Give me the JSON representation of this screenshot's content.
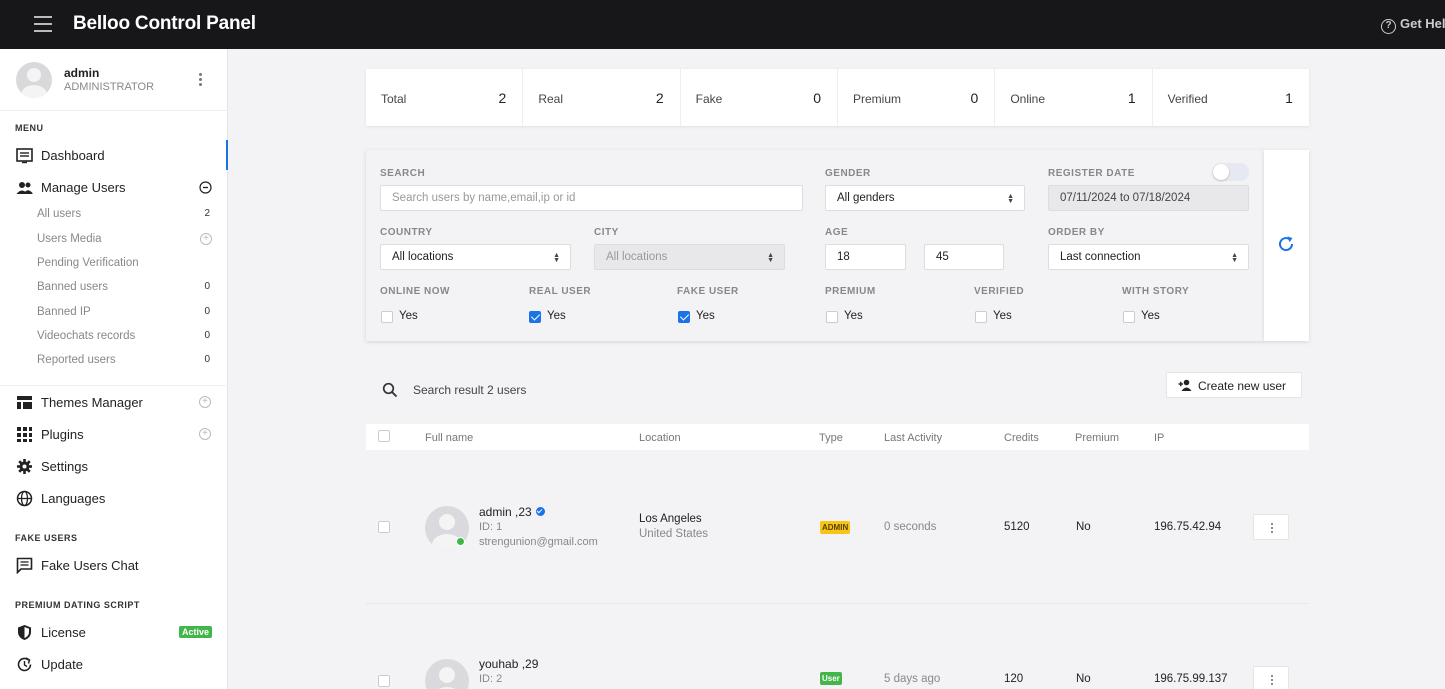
{
  "topbar": {
    "title": "Belloo Control Panel",
    "help": "Get Hel"
  },
  "profile": {
    "name": "admin",
    "role": "ADMINISTRATOR"
  },
  "sidebar": {
    "menu_label": "MENU",
    "dashboard": "Dashboard",
    "manage_users": "Manage Users",
    "sub_items": [
      {
        "label": "All users",
        "count": "2"
      },
      {
        "label": "Users Media",
        "count": ""
      },
      {
        "label": "Pending Verification",
        "count": ""
      },
      {
        "label": "Banned users",
        "count": "0"
      },
      {
        "label": "Banned IP",
        "count": "0"
      },
      {
        "label": "Videochats records",
        "count": "0"
      },
      {
        "label": "Reported users",
        "count": "0"
      }
    ],
    "themes_manager": "Themes Manager",
    "plugins": "Plugins",
    "settings": "Settings",
    "languages": "Languages",
    "fake_users_label": "FAKE USERS",
    "fake_users_chat": "Fake Users Chat",
    "premium_label": "PREMIUM DATING SCRIPT",
    "license": "License",
    "license_badge": "Active",
    "update": "Update"
  },
  "stats": [
    {
      "label": "Total",
      "value": "2"
    },
    {
      "label": "Real",
      "value": "2"
    },
    {
      "label": "Fake",
      "value": "0"
    },
    {
      "label": "Premium",
      "value": "0"
    },
    {
      "label": "Online",
      "value": "1"
    },
    {
      "label": "Verified",
      "value": "1"
    }
  ],
  "filters": {
    "search_label": "SEARCH",
    "search_placeholder": "Search users by name,email,ip or id",
    "gender_label": "GENDER",
    "gender_value": "All genders",
    "register_label": "REGISTER DATE",
    "register_value": "07/11/2024 to 07/18/2024",
    "country_label": "COUNTRY",
    "country_value": "All locations",
    "city_label": "CITY",
    "city_value": "All locations",
    "age_label": "AGE",
    "age_min": "18",
    "age_max": "45",
    "order_label": "ORDER BY",
    "order_value": "Last connection",
    "checks": [
      {
        "label": "ONLINE NOW",
        "option": "Yes",
        "checked": false
      },
      {
        "label": "REAL USER",
        "option": "Yes",
        "checked": true
      },
      {
        "label": "FAKE USER",
        "option": "Yes",
        "checked": true
      },
      {
        "label": "PREMIUM",
        "option": "Yes",
        "checked": false
      },
      {
        "label": "VERIFIED",
        "option": "Yes",
        "checked": false
      },
      {
        "label": "WITH STORY",
        "option": "Yes",
        "checked": false
      }
    ]
  },
  "results": {
    "text": "Search result 2 users",
    "create_label": "Create new user"
  },
  "table": {
    "headers": [
      "Full name",
      "Location",
      "Type",
      "Last Activity",
      "Credits",
      "Premium",
      "IP"
    ],
    "rows": [
      {
        "name": "admin ,23",
        "id": "ID: 1",
        "email": "strengunion@gmail.com",
        "city": "Los Angeles",
        "country": "United States",
        "type": "ADMIN",
        "last": "0 seconds",
        "credits": "5120",
        "premium": "No",
        "ip": "196.75.42.94"
      },
      {
        "name": "youhab ,29",
        "id": "ID: 2",
        "email": "",
        "city": "",
        "country": "",
        "type": "User",
        "last": "5 days ago",
        "credits": "120",
        "premium": "No",
        "ip": "196.75.99.137"
      }
    ]
  },
  "colors": {
    "accent": "#1a73e8",
    "topbar": "#17171a",
    "online": "#43b649",
    "admin_badge": "#f5c518"
  }
}
